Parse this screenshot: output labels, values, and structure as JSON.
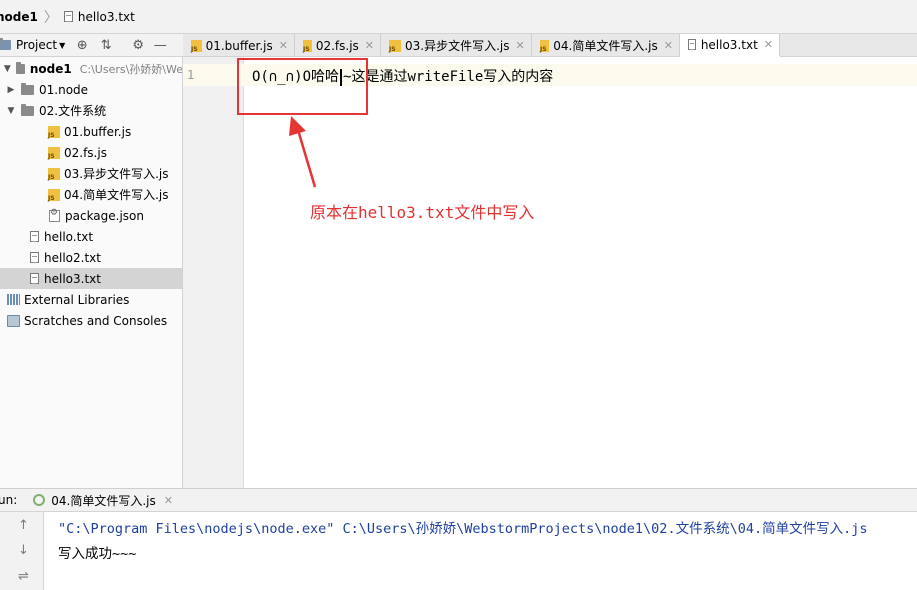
{
  "breadcrumb": {
    "root": "node1",
    "file": "hello3.txt"
  },
  "project_toolbar": {
    "label": "Project"
  },
  "tabs": [
    {
      "label": "01.buffer.js",
      "type": "js",
      "active": false
    },
    {
      "label": "02.fs.js",
      "type": "js",
      "active": false
    },
    {
      "label": "03.异步文件写入.js",
      "type": "js",
      "active": false
    },
    {
      "label": "04.简单文件写入.js",
      "type": "js",
      "active": false
    },
    {
      "label": "hello3.txt",
      "type": "txt",
      "active": true
    }
  ],
  "tree": {
    "root_label": "node1",
    "root_path": "C:\\Users\\孙娇娇\\We",
    "folder1": "01.node",
    "folder2": "02.文件系统",
    "file_buffer": "01.buffer.js",
    "file_fs": "02.fs.js",
    "file_async": "03.异步文件写入.js",
    "file_simple": "04.简单文件写入.js",
    "file_package": "package.json",
    "file_hello": "hello.txt",
    "file_hello2": "hello2.txt",
    "file_hello3": "hello3.txt",
    "external_libraries": "External Libraries",
    "scratches": "Scratches and Consoles"
  },
  "editor": {
    "line_number": "1",
    "code_before_caret": "O(∩_∩)O哈哈",
    "code_after_caret": "~这是通过writeFile写入的内容"
  },
  "annotation": {
    "text": "原本在hello3.txt文件中写入"
  },
  "run": {
    "label": "un:",
    "tab_label": "04.简单文件写入.js",
    "command": "\"C:\\Program Files\\nodejs\\node.exe\" C:\\Users\\孙娇娇\\WebstormProjects\\node1\\02.文件系统\\04.简单文件写入.js",
    "output": "写入成功~~~"
  },
  "colors": {
    "annotation": "#e53030",
    "selection": "#d4d4d4",
    "line_highlight": "#fcfaed"
  }
}
